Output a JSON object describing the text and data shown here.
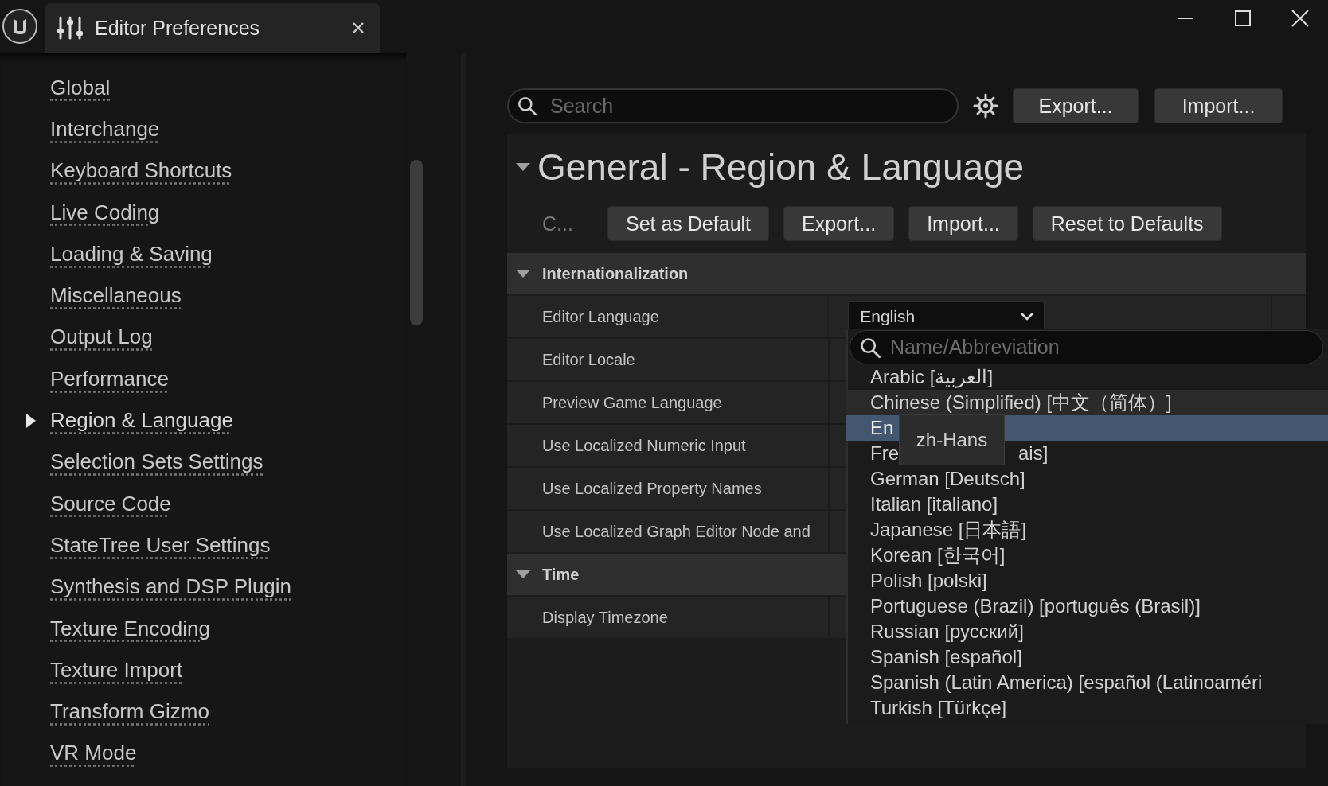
{
  "window": {
    "title": "Editor Preferences"
  },
  "sidebar": {
    "items": [
      {
        "label": "Global",
        "selected": false
      },
      {
        "label": "Interchange",
        "selected": false
      },
      {
        "label": "Keyboard Shortcuts",
        "selected": false
      },
      {
        "label": "Live Coding",
        "selected": false
      },
      {
        "label": "Loading & Saving",
        "selected": false
      },
      {
        "label": "Miscellaneous",
        "selected": false
      },
      {
        "label": "Output Log",
        "selected": false
      },
      {
        "label": "Performance",
        "selected": false
      },
      {
        "label": "Region & Language",
        "selected": true
      },
      {
        "label": "Selection Sets Settings",
        "selected": false
      },
      {
        "label": "Source Code",
        "selected": false
      },
      {
        "label": "StateTree User Settings",
        "selected": false
      },
      {
        "label": "Synthesis and DSP Plugin",
        "selected": false
      },
      {
        "label": "Texture Encoding",
        "selected": false
      },
      {
        "label": "Texture Import",
        "selected": false
      },
      {
        "label": "Transform Gizmo",
        "selected": false
      },
      {
        "label": "VR Mode",
        "selected": false
      }
    ]
  },
  "search": {
    "placeholder": "Search"
  },
  "toolbar_buttons": [
    "Export...",
    "Import..."
  ],
  "details": {
    "title": "General - Region & Language",
    "expanded": true,
    "truncated_label": "C...",
    "buttons": [
      "Set as Default",
      "Export...",
      "Import...",
      "Reset to Defaults"
    ],
    "sections": [
      {
        "title": "Internationalization",
        "expanded": true,
        "rows": [
          {
            "label": "Editor Language",
            "value": "English"
          },
          {
            "label": "Editor Locale"
          },
          {
            "label": "Preview Game Language"
          },
          {
            "label": "Use Localized Numeric Input"
          },
          {
            "label": "Use Localized Property Names"
          },
          {
            "label": "Use Localized Graph Editor Node and"
          }
        ]
      },
      {
        "title": "Time",
        "expanded": true,
        "rows": [
          {
            "label": "Display Timezone"
          }
        ]
      }
    ]
  },
  "language_menu": {
    "placeholder": "Name/Abbreviation",
    "tooltip": "zh-Hans",
    "items": [
      {
        "text": "Arabic [العربية]",
        "hovered": false,
        "selected": false
      },
      {
        "text": "Chinese (Simplified) [中文（简体）]",
        "hovered": true,
        "selected": false
      },
      {
        "text": "En",
        "hovered": false,
        "selected": true
      },
      {
        "text": "Fre",
        "text_after": "ais]",
        "hovered": false,
        "selected": false
      },
      {
        "text": "German [Deutsch]",
        "hovered": false,
        "selected": false
      },
      {
        "text": "Italian [italiano]",
        "hovered": false,
        "selected": false
      },
      {
        "text": "Japanese [日本語]",
        "hovered": false,
        "selected": false
      },
      {
        "text": "Korean [한국어]",
        "hovered": false,
        "selected": false
      },
      {
        "text": "Polish [polski]",
        "hovered": false,
        "selected": false
      },
      {
        "text": "Portuguese (Brazil) [português (Brasil)]",
        "hovered": false,
        "selected": false
      },
      {
        "text": "Russian [русский]",
        "hovered": false,
        "selected": false
      },
      {
        "text": "Spanish [español]",
        "hovered": false,
        "selected": false
      },
      {
        "text": "Spanish (Latin America) [español (Latinoaméri",
        "hovered": false,
        "selected": false
      },
      {
        "text": "Turkish [Türkçe]",
        "hovered": false,
        "selected": false
      }
    ]
  }
}
